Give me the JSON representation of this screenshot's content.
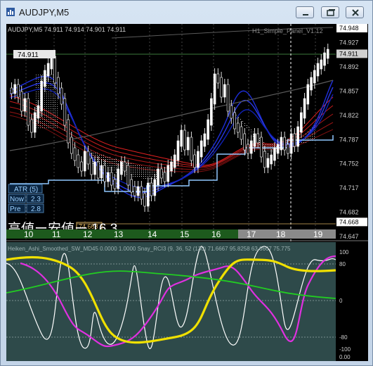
{
  "window": {
    "title": "AUDJPY,M5",
    "icon": "chart-window-icon",
    "buttons": [
      "minimize-icon",
      "restore-icon",
      "close-icon"
    ]
  },
  "chart_data": [
    {
      "type": "candlestick",
      "symbol_header": "AUDJPY,M5  74.911 74.914 74.901 74.911",
      "indicator_label": "H1_Simple_Panel_V1.12",
      "current_price": "74.911",
      "price_scale": [
        "74.948",
        "74.927",
        "74.911",
        "74.892",
        "74.857",
        "74.822",
        "74.787",
        "74.752",
        "74.717",
        "74.682",
        "74.668",
        "74.647"
      ],
      "ylim": [
        74.647,
        74.948
      ],
      "time_labels": [
        "10",
        "11",
        "12",
        "13",
        "14",
        "15",
        "16",
        "17",
        "18",
        "19"
      ],
      "atr_panel": {
        "title": "ATR (5)",
        "now_label": "Now",
        "now_value": "2.3",
        "pre_label": "Pre",
        "pre_value": "2.8"
      },
      "range_text": "高値ー安値ー 16.3",
      "low_marker": "74.668",
      "colors": {
        "up": "#ffffff",
        "down": "#ffffff",
        "ema_fast": "#1e2ed8",
        "ema_slow": "#c81414",
        "band_line": "#8fc8ff",
        "price_line": "#3c7a3c"
      }
    },
    {
      "type": "line",
      "title": "Heiken_Ashi_Smoothed_SW_MD45 0.0000 1.0000 Snay_RCI3 (9, 36, 52 (130) 71.6667 95.8258 63.6667 75.775",
      "ylim": [
        -100,
        100
      ],
      "y_ticks": [
        "100",
        "80",
        "0",
        "-80",
        "-100"
      ],
      "scale_bottom": "0.00",
      "series_colors": [
        "#ffffff",
        "#e030e0",
        "#f0e000",
        "#22cc22"
      ]
    }
  ]
}
